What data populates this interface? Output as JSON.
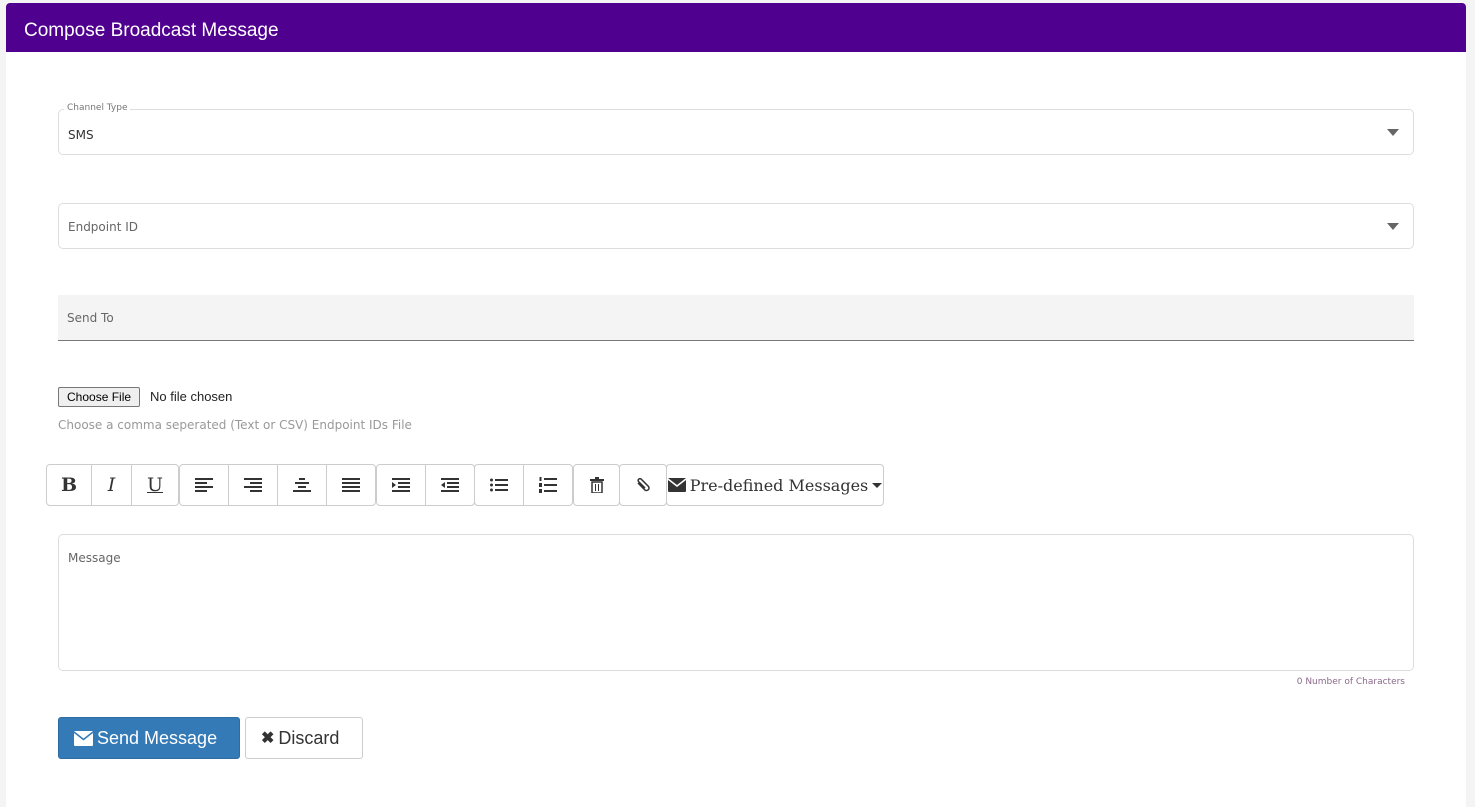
{
  "header": {
    "title": "Compose Broadcast Message"
  },
  "channel_type": {
    "label": "Channel Type",
    "value": "SMS"
  },
  "endpoint_id": {
    "placeholder": "Endpoint ID"
  },
  "send_to": {
    "placeholder": "Send To"
  },
  "file": {
    "button": "Choose File",
    "status": "No file chosen",
    "hint": "Choose a comma seperated (Text or CSV) Endpoint IDs File"
  },
  "toolbar": {
    "bold": "B",
    "italic": "I",
    "underline": "U",
    "predefined": "Pre-defined Messages"
  },
  "message": {
    "placeholder": "Message",
    "char_count": "0 Number of Characters"
  },
  "actions": {
    "send": "Send Message",
    "discard": "Discard"
  }
}
